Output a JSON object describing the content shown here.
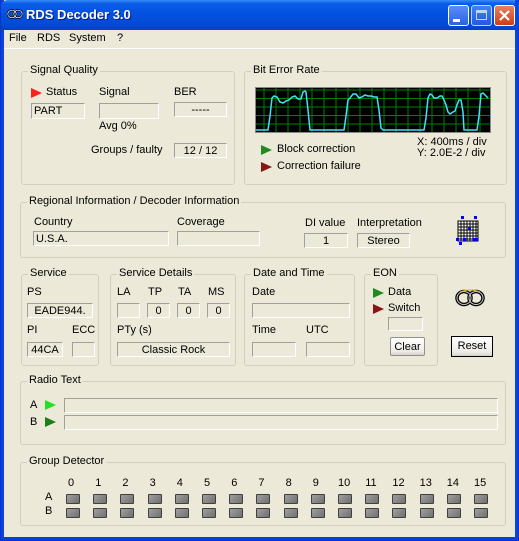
{
  "window": {
    "title": "RDS Decoder 3.0",
    "icon": "rds-logo-icon",
    "controls": [
      "minimize",
      "maximize",
      "close"
    ]
  },
  "menu": [
    "File",
    "RDS",
    "System",
    "?"
  ],
  "signal_quality": {
    "title": "Signal Quality",
    "status_label": "Status",
    "status_value": "PART",
    "status_flag_color": "#ff2020",
    "signal_label": "Signal",
    "signal_value": "",
    "ber_label": "BER",
    "ber_value": "-----",
    "avg_text": "Avg  0%",
    "groups_label": "Groups / faulty",
    "groups_value": "12 / 12"
  },
  "bit_error_rate": {
    "title": "Bit Error Rate",
    "legend": [
      {
        "label": "Block correction",
        "color": "#1e8c1e"
      },
      {
        "label": "Correction failure",
        "color": "#8c1414"
      }
    ],
    "x_scale": "X: 400ms / div",
    "y_scale": "Y: 2.0E-2 / div",
    "trace_color": "#40e0ff",
    "grid_color": "#008000"
  },
  "regional": {
    "title": "Regional Information / Decoder Information",
    "country_label": "Country",
    "country_value": "U.S.A.",
    "coverage_label": "Coverage",
    "coverage_value": "",
    "di_label": "DI value",
    "di_value": "1",
    "interp_label": "Interpretation",
    "interp_value": "Stereo"
  },
  "service": {
    "title": "Service",
    "ps_label": "PS",
    "ps_value": "EADE944.",
    "pi_label": "PI",
    "pi_value": "44CA",
    "ecc_label": "ECC",
    "ecc_value": ""
  },
  "service_details": {
    "title": "Service Details",
    "la_label": "LA",
    "la_value": "",
    "tp_label": "TP",
    "tp_value": "0",
    "ta_label": "TA",
    "ta_value": "0",
    "ms_label": "MS",
    "ms_value": "0",
    "pty_label": "PTy (s)",
    "pty_value": "Classic Rock"
  },
  "date_time": {
    "title": "Date and Time",
    "date_label": "Date",
    "date_value": "",
    "time_label": "Time",
    "time_value": "",
    "utc_label": "UTC",
    "utc_value": ""
  },
  "eon": {
    "title": "EON",
    "data_label": "Data",
    "switch_label": "Switch",
    "field_value": "",
    "clear_label": "Clear"
  },
  "reset_label": "Reset",
  "radio_text": {
    "title": "Radio Text",
    "a_label": "A",
    "a_value": "",
    "b_label": "B",
    "b_value": ""
  },
  "group_detector": {
    "title": "Group Detector",
    "columns": [
      "0",
      "1",
      "2",
      "3",
      "4",
      "5",
      "6",
      "7",
      "8",
      "9",
      "10",
      "11",
      "12",
      "13",
      "14",
      "15"
    ],
    "rows": [
      "A",
      "B"
    ]
  }
}
